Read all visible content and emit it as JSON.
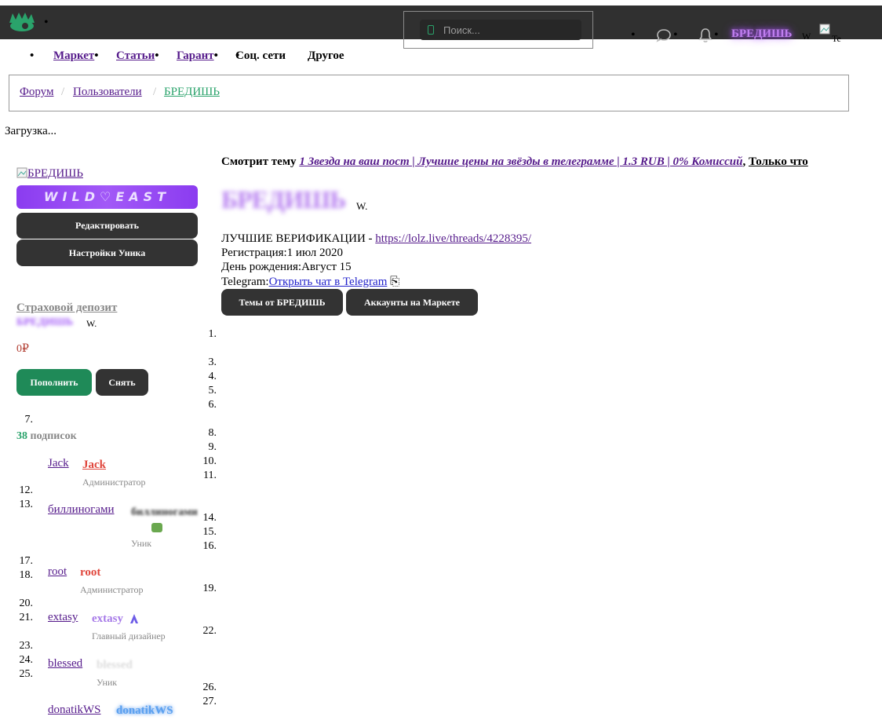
{
  "header": {
    "search_placeholder": "Поиск...",
    "username": "БРЕДИШЬ",
    "username_suffix": "W",
    "avatar_alt": "Te"
  },
  "nav": {
    "items": [
      "Маркет",
      "Статьи",
      "Гарант",
      "Соц. сети",
      "Другое"
    ]
  },
  "breadcrumb": [
    "Форум",
    "Пользователи",
    "БРЕДИШЬ"
  ],
  "loading_text": "Загрузка...",
  "sidebar": {
    "avatar_alt": "БРЕДИШЬ",
    "banner_text": "WILD♡EAST",
    "edit_label": "Редактировать",
    "unik_settings_label": "Настройки Уника",
    "deposit_title": "Страховой депозит",
    "deposit_suffix": "W.",
    "balance": "0₽",
    "deposit_button": "Пополнить",
    "withdraw_button": "Снять",
    "subs_count": "38",
    "subs_label": "подписок"
  },
  "subscriptions": [
    {
      "link": "Jack",
      "name": "Jack",
      "role": "Администратор"
    },
    {
      "link": "биллиногами",
      "name": "биллиногами",
      "role": "Уник"
    },
    {
      "link": "root",
      "name": "root",
      "role": "Администратор"
    },
    {
      "link": "extasy",
      "name": "extasy",
      "role": "Главный дизайнер"
    },
    {
      "link": "blessed",
      "name": "blessed",
      "role": "Уник"
    },
    {
      "link": "donatikWS",
      "name": "donatikWS",
      "role": ""
    }
  ],
  "profile": {
    "watching_label": "Смотрит тему",
    "watching_thread": "1 Звезда на ваш пост | Лучшие цены на звёзды в телеграмме | 1.3 RUB | 0% Комиссий",
    "watching_time": "Только что",
    "big_name": "БРЕДИШЬ",
    "name_suffix": "W.",
    "status_text": "ЛУЧШИЕ ВЕРИФИКАЦИИ -",
    "status_link": "https://lolz.live/threads/4228395/",
    "reg_label": "Регистрация:",
    "reg_value": "1 июл 2020",
    "bday_label": "День рождения:",
    "bday_value": "Август 15",
    "tg_label": "Telegram:",
    "tg_link": "Открыть чат в Telegram",
    "tg_glyph": "⎘",
    "topics_button": "Темы от БРЕДИШЬ",
    "accounts_button": "Аккаунты на Маркете"
  },
  "list_numbers_main": [
    "1.",
    "3.",
    "4.",
    "5.",
    "6.",
    "8.",
    "9.",
    "10.",
    "11.",
    "14.",
    "15.",
    "16.",
    "19.",
    "22.",
    "26.",
    "27."
  ],
  "list_numbers_side": [
    "7.",
    "12.",
    "13.",
    "17.",
    "18.",
    "20.",
    "21.",
    "23.",
    "24.",
    "25."
  ],
  "colors": {
    "topbar": "#303030",
    "accent_green": "#2aa36b",
    "purple": "#a259f7",
    "admin_red": "#e0463c"
  }
}
